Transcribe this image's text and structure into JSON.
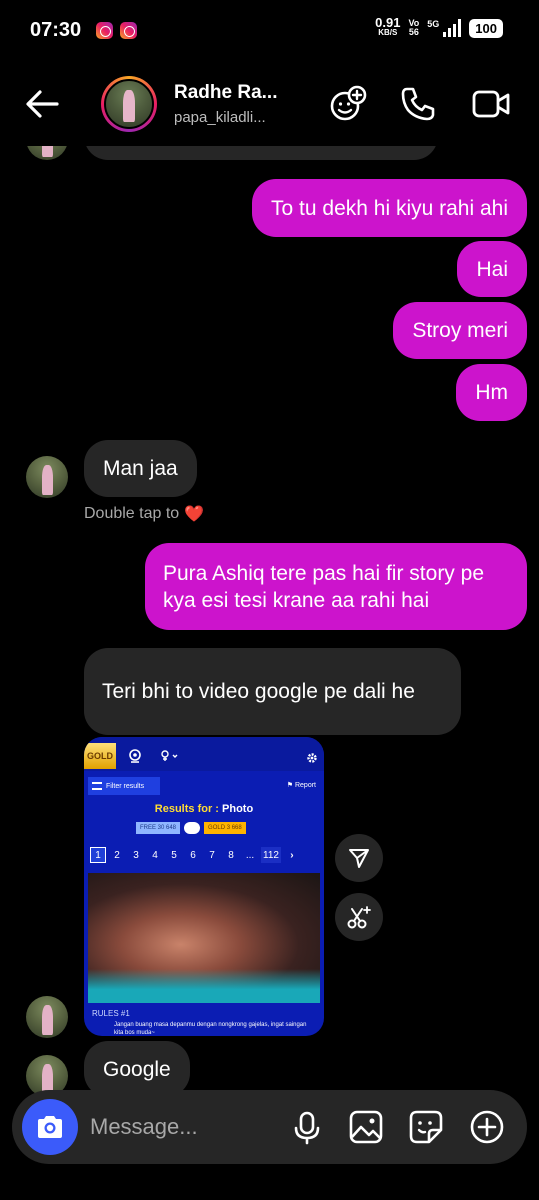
{
  "status_bar": {
    "time": "07:30",
    "speed_value": "0.91",
    "speed_unit": "KB/S",
    "volte_top": "Vo",
    "volte_bottom": "56",
    "network": "5G",
    "battery": "100"
  },
  "header": {
    "name": "Radhe Ra...",
    "username": "papa_kiladli...",
    "icons": [
      "back-arrow-icon",
      "effects-icon",
      "phone-icon",
      "video-icon"
    ]
  },
  "messages": [
    {
      "direction": "out",
      "text": "To tu dekh hi kiyu rahi ahi"
    },
    {
      "direction": "out",
      "text": "Hai"
    },
    {
      "direction": "out",
      "text": "Stroy meri"
    },
    {
      "direction": "out",
      "text": "Hm"
    },
    {
      "direction": "in",
      "text": "Man jaa"
    },
    {
      "direction": "out",
      "text": "Pura Ashiq tere pas hai fir story pe kya esi tesi krane aa rahi hai"
    },
    {
      "direction": "in",
      "text": "Teri bhi to video google pe dali he"
    },
    {
      "direction": "in",
      "text": "Google"
    }
  ],
  "double_tap_hint": "Double tap to",
  "heart_emoji": "❤️",
  "shared_image": {
    "gold_badge": "GOLD",
    "filter_label": "Filter results",
    "report_label": "Report",
    "results_for": "Results for :",
    "results_category": "Photo",
    "free_chip": "FREE 30 648",
    "gold_chip": "GOLD 3 668",
    "pages": [
      "1",
      "2",
      "3",
      "4",
      "5",
      "6",
      "7",
      "8",
      "...",
      "112"
    ],
    "rules_label": "RULES #1",
    "rules_text": "Jangan buang masa depanmu dengan nongkrong gajelas, ingat saingan kita bos muda~"
  },
  "composer": {
    "placeholder": "Message..."
  },
  "colors": {
    "outgoing_bubble": "#cc14cc",
    "incoming_bubble": "#262626",
    "camera_button": "#3b5bfa",
    "background": "#000000"
  }
}
